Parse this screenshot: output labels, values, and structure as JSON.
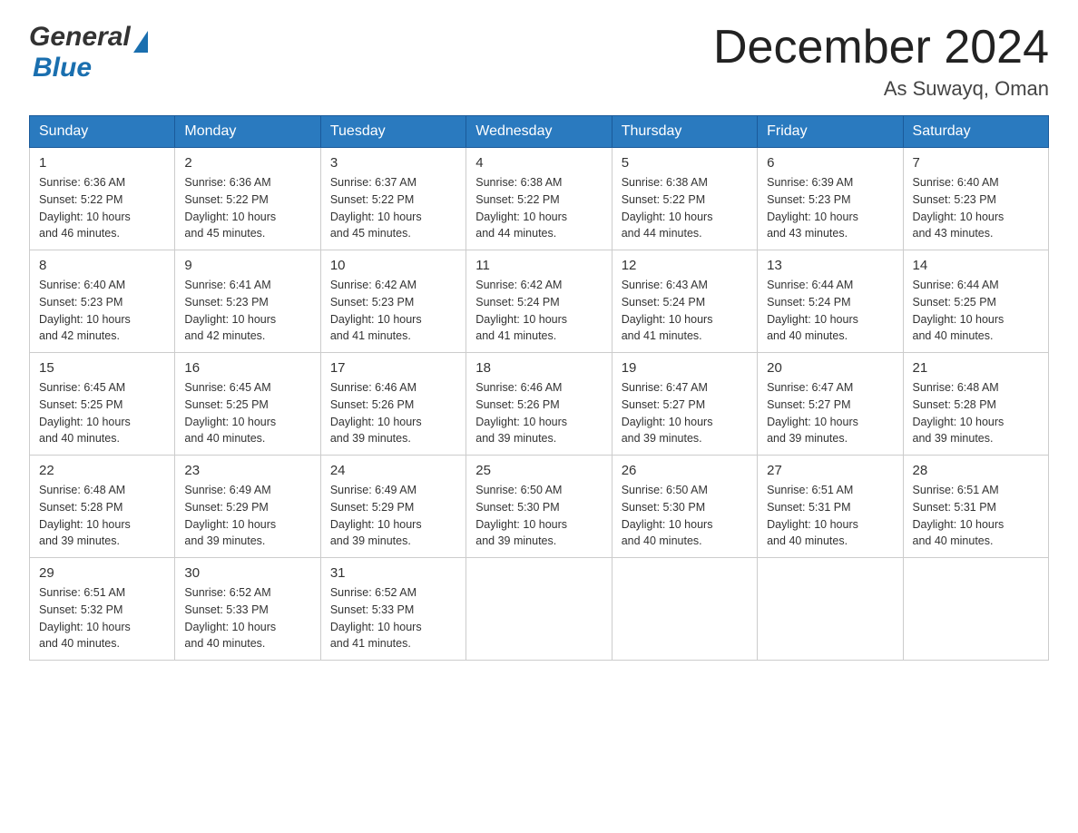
{
  "header": {
    "logo_general": "General",
    "logo_blue": "Blue",
    "title": "December 2024",
    "subtitle": "As Suwayq, Oman"
  },
  "days_of_week": [
    "Sunday",
    "Monday",
    "Tuesday",
    "Wednesday",
    "Thursday",
    "Friday",
    "Saturday"
  ],
  "weeks": [
    [
      {
        "day": "1",
        "sunrise": "6:36 AM",
        "sunset": "5:22 PM",
        "daylight": "10 hours and 46 minutes."
      },
      {
        "day": "2",
        "sunrise": "6:36 AM",
        "sunset": "5:22 PM",
        "daylight": "10 hours and 45 minutes."
      },
      {
        "day": "3",
        "sunrise": "6:37 AM",
        "sunset": "5:22 PM",
        "daylight": "10 hours and 45 minutes."
      },
      {
        "day": "4",
        "sunrise": "6:38 AM",
        "sunset": "5:22 PM",
        "daylight": "10 hours and 44 minutes."
      },
      {
        "day": "5",
        "sunrise": "6:38 AM",
        "sunset": "5:22 PM",
        "daylight": "10 hours and 44 minutes."
      },
      {
        "day": "6",
        "sunrise": "6:39 AM",
        "sunset": "5:23 PM",
        "daylight": "10 hours and 43 minutes."
      },
      {
        "day": "7",
        "sunrise": "6:40 AM",
        "sunset": "5:23 PM",
        "daylight": "10 hours and 43 minutes."
      }
    ],
    [
      {
        "day": "8",
        "sunrise": "6:40 AM",
        "sunset": "5:23 PM",
        "daylight": "10 hours and 42 minutes."
      },
      {
        "day": "9",
        "sunrise": "6:41 AM",
        "sunset": "5:23 PM",
        "daylight": "10 hours and 42 minutes."
      },
      {
        "day": "10",
        "sunrise": "6:42 AM",
        "sunset": "5:23 PM",
        "daylight": "10 hours and 41 minutes."
      },
      {
        "day": "11",
        "sunrise": "6:42 AM",
        "sunset": "5:24 PM",
        "daylight": "10 hours and 41 minutes."
      },
      {
        "day": "12",
        "sunrise": "6:43 AM",
        "sunset": "5:24 PM",
        "daylight": "10 hours and 41 minutes."
      },
      {
        "day": "13",
        "sunrise": "6:44 AM",
        "sunset": "5:24 PM",
        "daylight": "10 hours and 40 minutes."
      },
      {
        "day": "14",
        "sunrise": "6:44 AM",
        "sunset": "5:25 PM",
        "daylight": "10 hours and 40 minutes."
      }
    ],
    [
      {
        "day": "15",
        "sunrise": "6:45 AM",
        "sunset": "5:25 PM",
        "daylight": "10 hours and 40 minutes."
      },
      {
        "day": "16",
        "sunrise": "6:45 AM",
        "sunset": "5:25 PM",
        "daylight": "10 hours and 40 minutes."
      },
      {
        "day": "17",
        "sunrise": "6:46 AM",
        "sunset": "5:26 PM",
        "daylight": "10 hours and 39 minutes."
      },
      {
        "day": "18",
        "sunrise": "6:46 AM",
        "sunset": "5:26 PM",
        "daylight": "10 hours and 39 minutes."
      },
      {
        "day": "19",
        "sunrise": "6:47 AM",
        "sunset": "5:27 PM",
        "daylight": "10 hours and 39 minutes."
      },
      {
        "day": "20",
        "sunrise": "6:47 AM",
        "sunset": "5:27 PM",
        "daylight": "10 hours and 39 minutes."
      },
      {
        "day": "21",
        "sunrise": "6:48 AM",
        "sunset": "5:28 PM",
        "daylight": "10 hours and 39 minutes."
      }
    ],
    [
      {
        "day": "22",
        "sunrise": "6:48 AM",
        "sunset": "5:28 PM",
        "daylight": "10 hours and 39 minutes."
      },
      {
        "day": "23",
        "sunrise": "6:49 AM",
        "sunset": "5:29 PM",
        "daylight": "10 hours and 39 minutes."
      },
      {
        "day": "24",
        "sunrise": "6:49 AM",
        "sunset": "5:29 PM",
        "daylight": "10 hours and 39 minutes."
      },
      {
        "day": "25",
        "sunrise": "6:50 AM",
        "sunset": "5:30 PM",
        "daylight": "10 hours and 39 minutes."
      },
      {
        "day": "26",
        "sunrise": "6:50 AM",
        "sunset": "5:30 PM",
        "daylight": "10 hours and 40 minutes."
      },
      {
        "day": "27",
        "sunrise": "6:51 AM",
        "sunset": "5:31 PM",
        "daylight": "10 hours and 40 minutes."
      },
      {
        "day": "28",
        "sunrise": "6:51 AM",
        "sunset": "5:31 PM",
        "daylight": "10 hours and 40 minutes."
      }
    ],
    [
      {
        "day": "29",
        "sunrise": "6:51 AM",
        "sunset": "5:32 PM",
        "daylight": "10 hours and 40 minutes."
      },
      {
        "day": "30",
        "sunrise": "6:52 AM",
        "sunset": "5:33 PM",
        "daylight": "10 hours and 40 minutes."
      },
      {
        "day": "31",
        "sunrise": "6:52 AM",
        "sunset": "5:33 PM",
        "daylight": "10 hours and 41 minutes."
      },
      null,
      null,
      null,
      null
    ]
  ],
  "labels": {
    "sunrise": "Sunrise:",
    "sunset": "Sunset:",
    "daylight": "Daylight:"
  }
}
